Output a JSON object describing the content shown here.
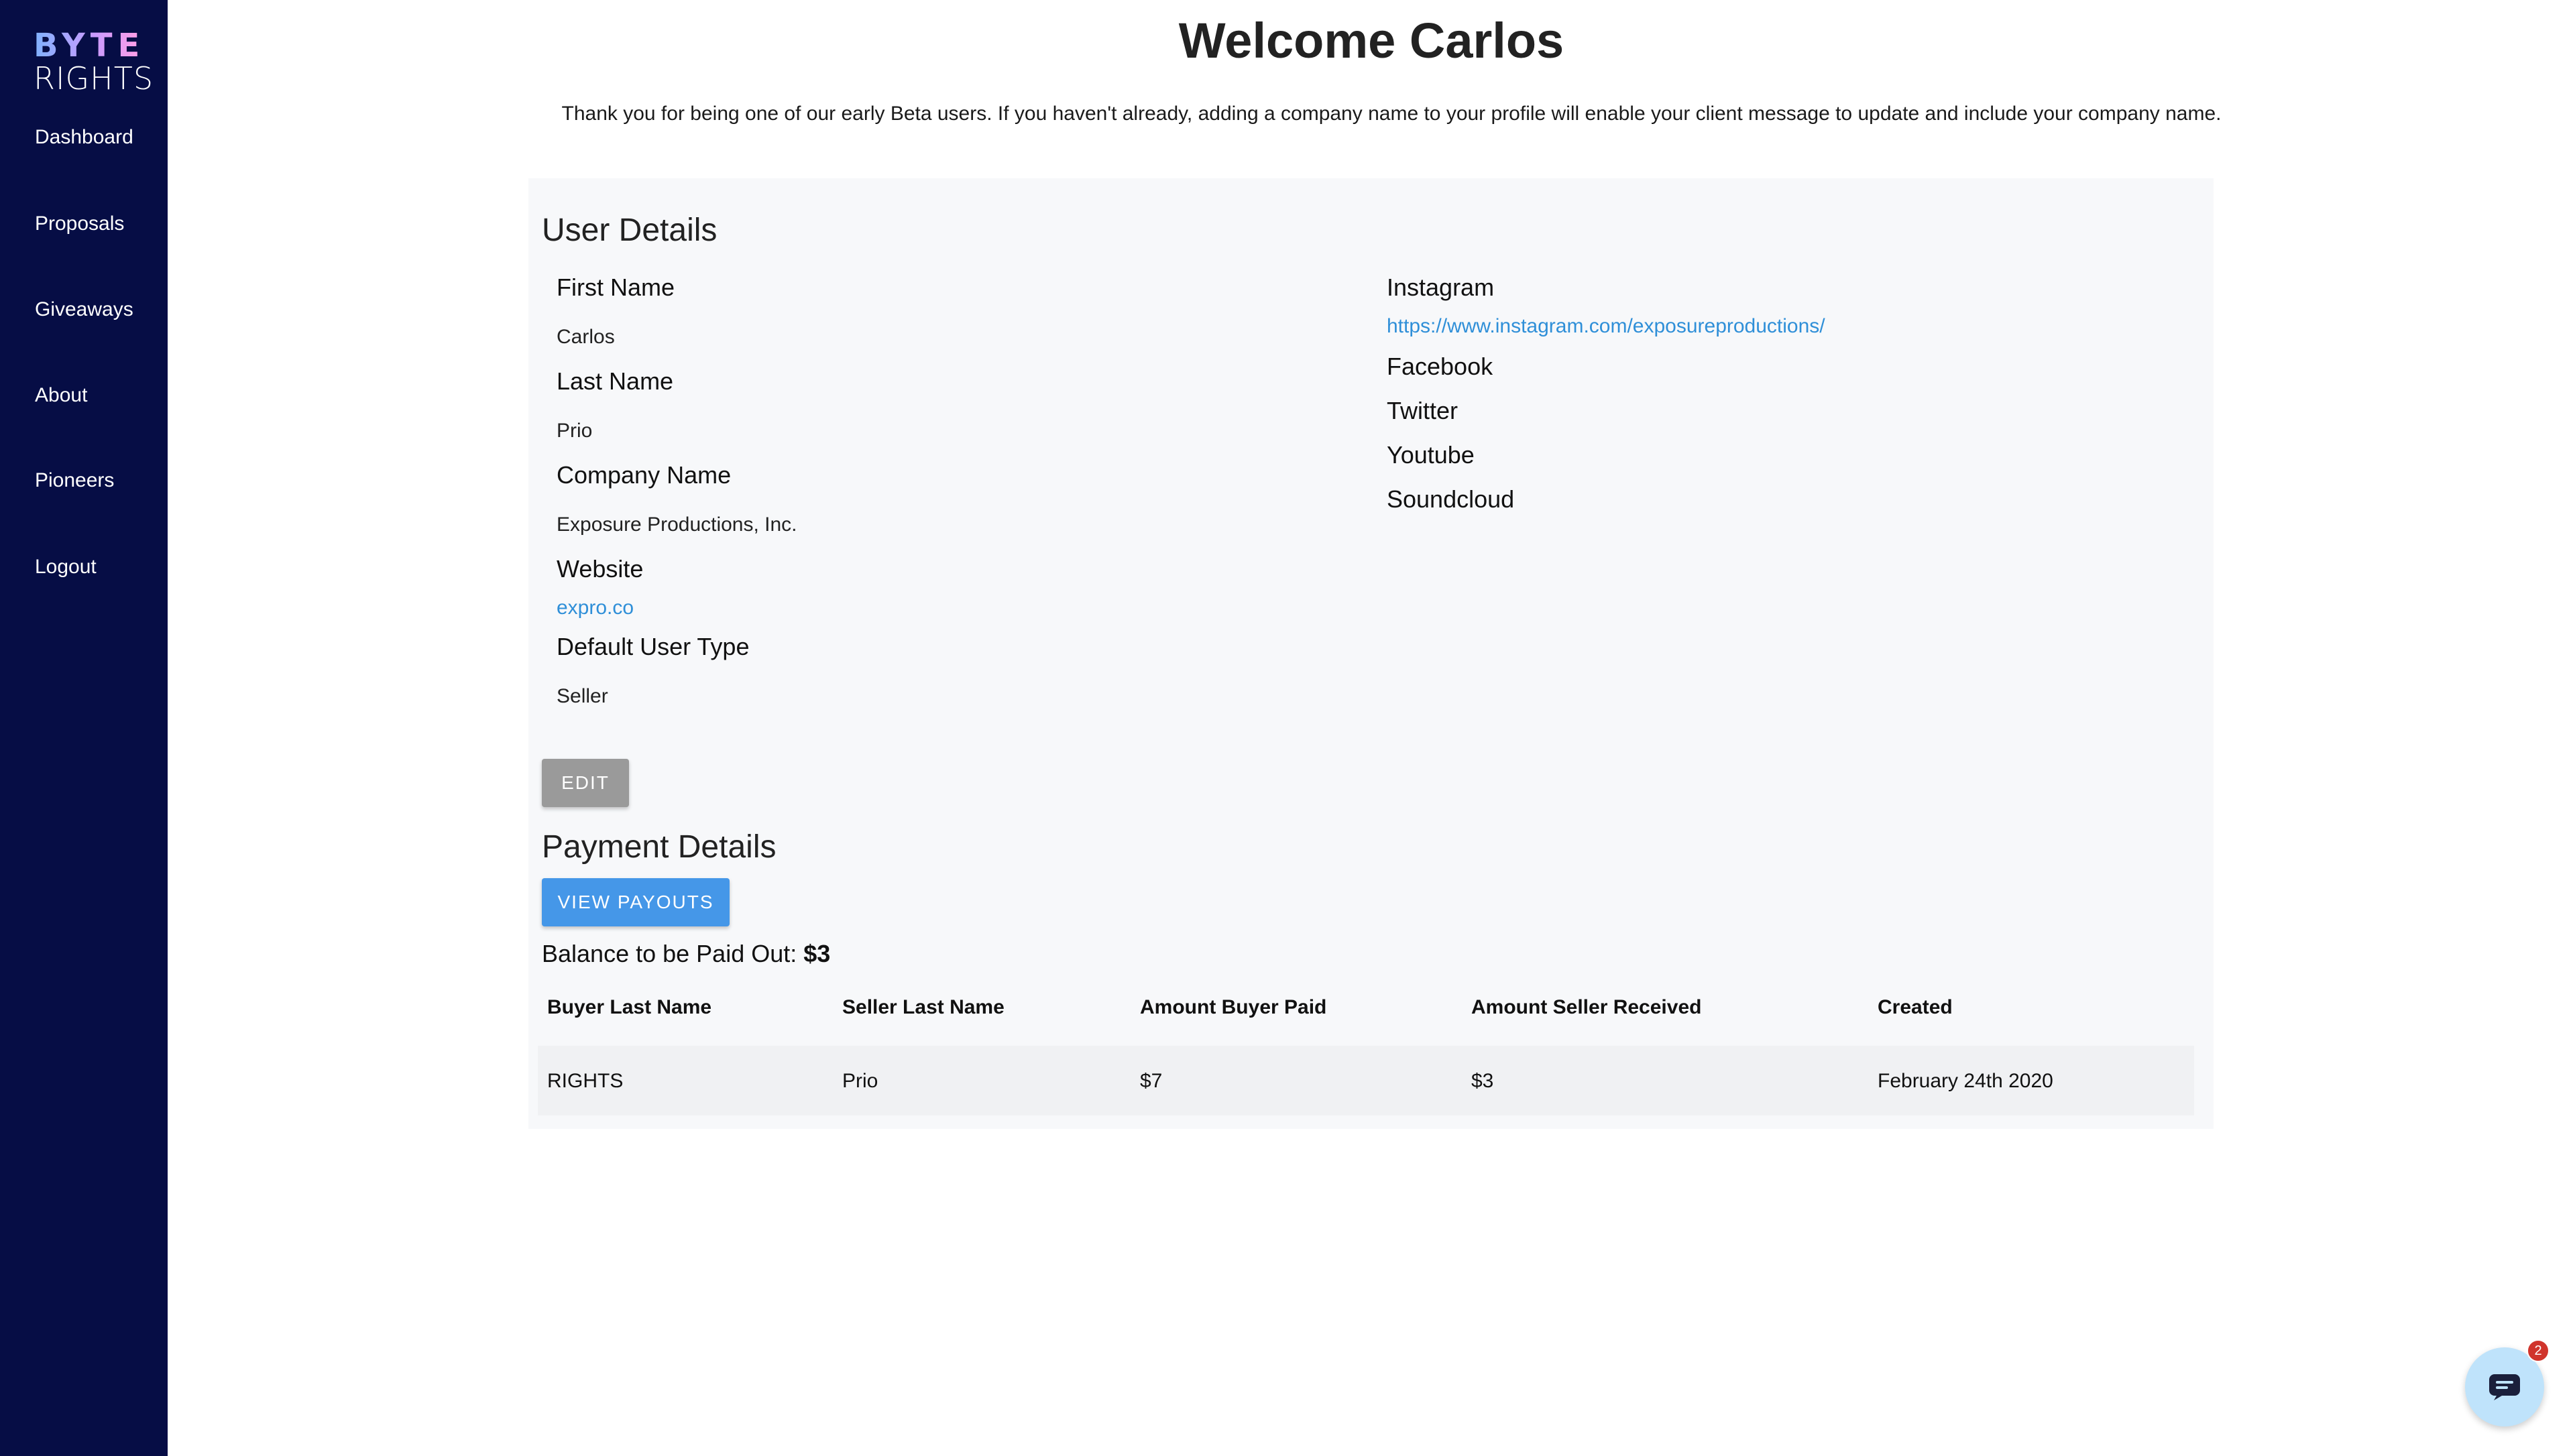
{
  "sidebar": {
    "logo_top": "BYTE",
    "logo_bottom": "RIGHTS",
    "items": [
      "Dashboard",
      "Proposals",
      "Giveaways",
      "About",
      "Pioneers",
      "Logout"
    ]
  },
  "header": {
    "title": "Welcome Carlos",
    "intro": "Thank you for being one of our early Beta users. If you haven't already, adding a company name to your profile will enable your client message to update and include your company name."
  },
  "user_details": {
    "title": "User Details",
    "first_name_label": "First Name",
    "first_name": "Carlos",
    "last_name_label": "Last Name",
    "last_name": "Prio",
    "company_label": "Company Name",
    "company": "Exposure Productions, Inc.",
    "website_label": "Website",
    "website": "expro.co",
    "user_type_label": "Default User Type",
    "user_type": "Seller",
    "instagram_label": "Instagram",
    "instagram": "https://www.instagram.com/exposureproductions/",
    "facebook_label": "Facebook",
    "twitter_label": "Twitter",
    "youtube_label": "Youtube",
    "soundcloud_label": "Soundcloud",
    "edit_label": "EDIT"
  },
  "payment": {
    "title": "Payment Details",
    "view_payouts_label": "VIEW PAYOUTS",
    "balance_label": "Balance to be Paid Out:",
    "balance_value": "$3",
    "columns": [
      "Buyer Last Name",
      "Seller Last Name",
      "Amount Buyer Paid",
      "Amount Seller Received",
      "Created"
    ],
    "rows": [
      [
        "RIGHTS",
        "Prio",
        "$7",
        "$3",
        "February 24th 2020"
      ]
    ]
  },
  "chat": {
    "icon": "chat-bubble-icon",
    "badge_count": "2"
  },
  "colors": {
    "sidebar_bg": "#060d45",
    "link": "#2f8fd8",
    "primary_button": "#4597e8",
    "edit_button": "#9a9a9a",
    "panel_bg": "#f7f8fa",
    "badge": "#d0342c"
  }
}
